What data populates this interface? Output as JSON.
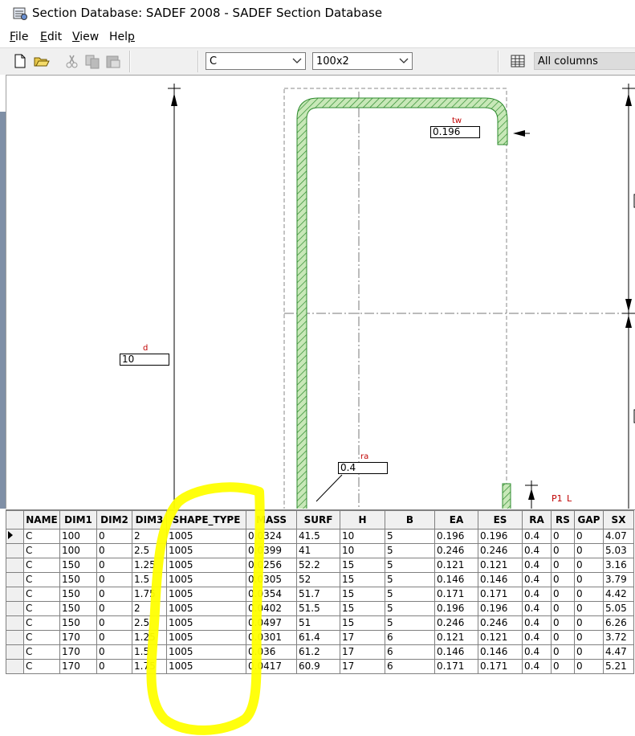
{
  "window": {
    "title": "Section Database: SADEF 2008 - SADEF Section Database"
  },
  "menu": {
    "file": "File",
    "edit": "Edit",
    "view": "View",
    "help": "Help"
  },
  "toolbar": {
    "icons": [
      "new-document-icon",
      "open-folder-icon",
      "cut-icon",
      "copy-icon",
      "paste-icon"
    ],
    "section_type": "C",
    "section_size": "100x2",
    "columns_mode": "All columns"
  },
  "drawing": {
    "tw_label": "tw",
    "tw_value": "0.196",
    "d_label": "d",
    "d_value": "10",
    "ra_label": "ra",
    "ra_value": "0.4",
    "p1_label": "P1",
    "l_label": "L"
  },
  "colors": {
    "hatch_fill": "#c8e8b8",
    "hatch_stroke": "#2e8b2e",
    "dim_label": "#c00000",
    "highlight": "#ffff00"
  },
  "grid": {
    "columns": [
      "NAME",
      "DIM1",
      "DIM2",
      "DIM3",
      "SHAPE_TYPE",
      "MASS",
      "SURF",
      "H",
      "B",
      "EA",
      "ES",
      "RA",
      "RS",
      "GAP",
      "SX"
    ],
    "rows": [
      [
        "C",
        "100",
        "0",
        "2",
        "1005",
        "0.0324",
        "41.5",
        "10",
        "5",
        "0.196",
        "0.196",
        "0.4",
        "0",
        "0",
        "4.07"
      ],
      [
        "C",
        "100",
        "0",
        "2.5",
        "1005",
        "0.0399",
        "41",
        "10",
        "5",
        "0.246",
        "0.246",
        "0.4",
        "0",
        "0",
        "5.03"
      ],
      [
        "C",
        "150",
        "0",
        "1.25",
        "1005",
        "0.0256",
        "52.2",
        "15",
        "5",
        "0.121",
        "0.121",
        "0.4",
        "0",
        "0",
        "3.16"
      ],
      [
        "C",
        "150",
        "0",
        "1.5",
        "1005",
        "0.0305",
        "52",
        "15",
        "5",
        "0.146",
        "0.146",
        "0.4",
        "0",
        "0",
        "3.79"
      ],
      [
        "C",
        "150",
        "0",
        "1.75",
        "1005",
        "0.0354",
        "51.7",
        "15",
        "5",
        "0.171",
        "0.171",
        "0.4",
        "0",
        "0",
        "4.42"
      ],
      [
        "C",
        "150",
        "0",
        "2",
        "1005",
        "0.0402",
        "51.5",
        "15",
        "5",
        "0.196",
        "0.196",
        "0.4",
        "0",
        "0",
        "5.05"
      ],
      [
        "C",
        "150",
        "0",
        "2.5",
        "1005",
        "0.0497",
        "51",
        "15",
        "5",
        "0.246",
        "0.246",
        "0.4",
        "0",
        "0",
        "6.26"
      ],
      [
        "C",
        "170",
        "0",
        "1.25",
        "1005",
        "0.0301",
        "61.4",
        "17",
        "6",
        "0.121",
        "0.121",
        "0.4",
        "0",
        "0",
        "3.72"
      ],
      [
        "C",
        "170",
        "0",
        "1.5",
        "1005",
        "0.036",
        "61.2",
        "17",
        "6",
        "0.146",
        "0.146",
        "0.4",
        "0",
        "0",
        "4.47"
      ],
      [
        "C",
        "170",
        "0",
        "1.75",
        "1005",
        "0.0417",
        "60.9",
        "17",
        "6",
        "0.171",
        "0.171",
        "0.4",
        "0",
        "0",
        "5.21"
      ]
    ]
  }
}
